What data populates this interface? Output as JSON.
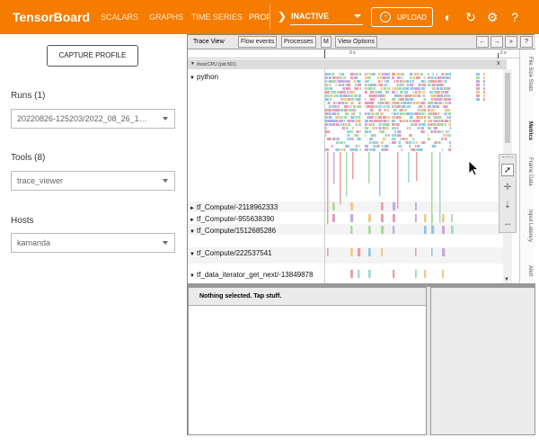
{
  "header": {
    "brand": "TensorBoard",
    "nav": [
      "SCALARS",
      "GRAPHS",
      "TIME SERIES",
      "PROFI"
    ],
    "active_nav": "PROFI",
    "status_select": "INACTIVE",
    "upload_label": "UPLOAD",
    "icons": [
      "theme-icon",
      "refresh-icon",
      "settings-icon",
      "help-icon"
    ]
  },
  "left": {
    "capture_label": "CAPTURE PROFILE",
    "runs_label": "Runs (1)",
    "runs_value": "20220826-125203/2022_08_26_1…",
    "tools_label": "Tools (8)",
    "tools_value": "trace_viewer",
    "hosts_label": "Hosts",
    "hosts_value": "kamanda"
  },
  "trace": {
    "tab": "Trace View",
    "buttons": [
      "Flow events",
      "Processes",
      "M",
      "View Options"
    ],
    "nav_buttons": [
      "←",
      "→",
      "»",
      "?"
    ],
    "ruler_0": "0 s",
    "ruler_2": "2 s",
    "host_label": "/host:CPU (pid 501)",
    "close": "x",
    "tracks": [
      {
        "tri": "▼",
        "name": "python"
      },
      {
        "tri": "►",
        "name": "tf_Compute/-2118962333"
      },
      {
        "tri": "►",
        "name": "tf_Compute/-955638390"
      },
      {
        "tri": "▼",
        "name": "tf_Compute/1512685286"
      },
      {
        "tri": "▼",
        "name": "tf_Compute/222537541"
      },
      {
        "tri": "▼",
        "name": "tf_data_iterator_get_next/-13849878"
      }
    ],
    "side_tabs": [
      "File Size Stats",
      "Metrics",
      "Frame Data",
      "Input Latency",
      "Alert"
    ],
    "nothing_selected": "Nothing selected. Tap stuff."
  },
  "colors": {
    "header": "#f57c00",
    "slice_palette": [
      "#8fc5e8",
      "#a7d9a3",
      "#e89ac0",
      "#c4a9e0",
      "#f0c98a",
      "#9fd8d0",
      "#e8a0a0"
    ]
  }
}
